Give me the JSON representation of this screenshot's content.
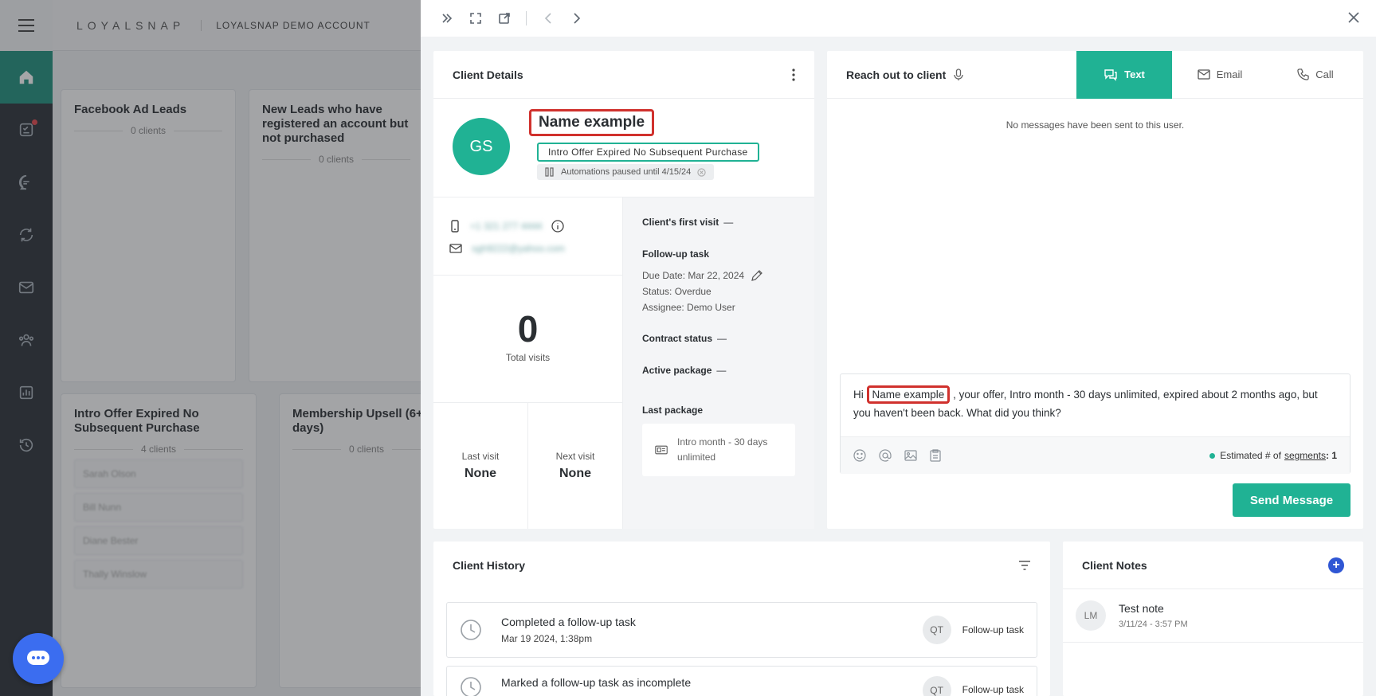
{
  "app": {
    "logo": "LOYALSNAP",
    "account": "LOYALSNAP DEMO ACCOUNT"
  },
  "nav": {
    "icons": [
      "home-icon",
      "tasks-icon",
      "messages-icon",
      "automations-icon",
      "email-icon",
      "clients-icon",
      "reports-icon",
      "history-icon"
    ]
  },
  "board": {
    "columns": [
      {
        "title": "Facebook Ad Leads",
        "count": "0 clients"
      },
      {
        "title": "New Leads who have registered an account but not purchased",
        "count": "0 clients"
      },
      {
        "title": "Intro Offer Expired No Subsequent Purchase",
        "count": "4 clients"
      },
      {
        "title": "Membership Upsell (6+ 30 days)",
        "count": "0 clients"
      }
    ],
    "cards": [
      "Sarah Olson",
      "Bill Nunn",
      "Diane Bester",
      "Thally Winslow"
    ]
  },
  "client_details": {
    "title": "Client Details",
    "initials": "GS",
    "name": "Name example",
    "tag": "Intro Offer Expired No Subsequent Purchase",
    "paused": "Automations paused until 4/15/24",
    "phone": "+1 321 277 4444",
    "email": "sgh9222@yahoo.com",
    "total_visits": "0",
    "total_visits_label": "Total visits",
    "last_visit_label": "Last visit",
    "last_visit": "None",
    "next_visit_label": "Next visit",
    "next_visit": "None",
    "first_visit_label": "Client's first visit",
    "dash": "—",
    "followup_label": "Follow-up task",
    "due_date": "Due Date: Mar 22, 2024",
    "status": "Status: Overdue",
    "assignee": "Assignee: Demo User",
    "contract_label": "Contract status",
    "active_pkg_label": "Active package",
    "last_pkg_label": "Last package",
    "last_pkg": "Intro month - 30 days unlimited"
  },
  "reach_out": {
    "title": "Reach out to client",
    "tabs": [
      "Text",
      "Email",
      "Call"
    ],
    "no_messages": "No messages have been sent to this user.",
    "msg_prefix": "Hi",
    "msg_name": "Name example",
    "msg_rest": ", your offer, Intro month - 30 days unlimited, expired about 2 months ago, but you haven't been back. What did you think?",
    "est_label": "Estimated # of",
    "est_link": "segments",
    "est_value": ": 1",
    "send": "Send Message"
  },
  "history": {
    "title": "Client History",
    "items": [
      {
        "title": "Completed a follow-up task",
        "date": "Mar 19 2024, 1:38pm",
        "user": "QT",
        "kind": "Follow-up task"
      },
      {
        "title": "Marked a follow-up task as incomplete",
        "date": "",
        "user": "QT",
        "kind": "Follow-up task"
      }
    ]
  },
  "notes": {
    "title": "Client Notes",
    "items": [
      {
        "initials": "LM",
        "title": "Test note",
        "date": "3/11/24 - 3:57 PM"
      }
    ]
  },
  "colors": {
    "accent": "#20b294",
    "highlight": "#d0312d",
    "nav_bg": "#2b3138",
    "chat": "#3b6df0"
  }
}
